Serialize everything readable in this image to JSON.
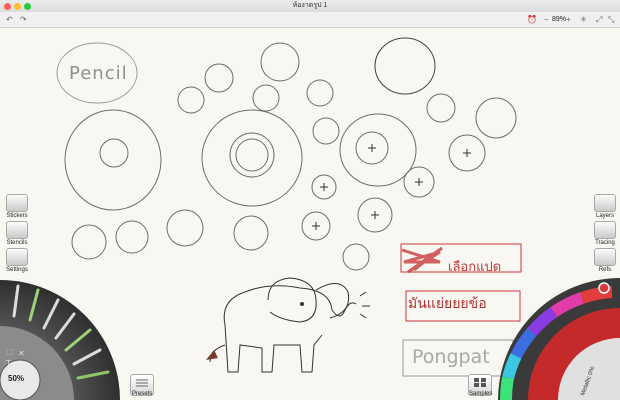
{
  "window": {
    "title": "ห้องาดรูป 1"
  },
  "toolbar": {
    "zoom_label": "89%",
    "minus": "−",
    "plus": "+"
  },
  "left_panel": {
    "stickers": "Stickers",
    "stencils": "Stencils",
    "settings": "Settings"
  },
  "right_panel": {
    "layers": "Layers",
    "tracing": "Tracing",
    "refs": "Refs"
  },
  "bottom": {
    "presets": "Presets",
    "samples": "Samples",
    "tool_size": "50%",
    "color_readout": "Metallic 0%"
  },
  "canvas": {
    "pencil_text": "Pencil",
    "thai_line_1": "เลือกแปด",
    "thai_line_2": "มันแย่ยยยข้อ",
    "name_text": "Pongpat"
  },
  "colors": {
    "accent_red": "#c83a3a",
    "canvas": "#f8f7f2"
  }
}
